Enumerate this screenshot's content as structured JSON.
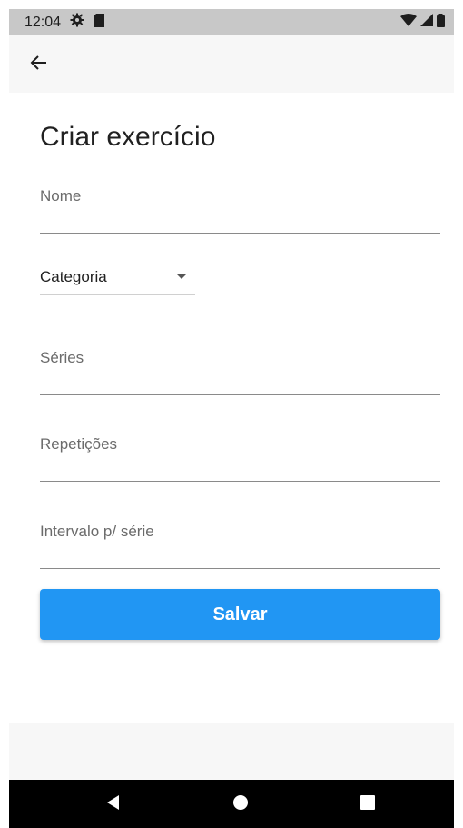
{
  "status_bar": {
    "time": "12:04",
    "icons": [
      "gear-icon",
      "sd-card-icon",
      "wifi-icon",
      "signal-icon",
      "battery-icon"
    ]
  },
  "app_bar": {
    "back_icon": "arrow-back-icon"
  },
  "form": {
    "title": "Criar exercício",
    "fields": [
      {
        "label": "Nome",
        "value": ""
      },
      {
        "label": "Séries",
        "value": ""
      },
      {
        "label": "Repetições",
        "value": ""
      },
      {
        "label": "Intervalo p/ série",
        "value": ""
      }
    ],
    "category": {
      "selected": "Categoria"
    },
    "save_label": "Salvar"
  },
  "nav_bar": {
    "icons": [
      "back-triangle-icon",
      "home-circle-icon",
      "recents-square-icon"
    ]
  },
  "colors": {
    "accent": "#2196f3",
    "status_bar": "#c8c8c8",
    "nav_bar": "#000000"
  }
}
